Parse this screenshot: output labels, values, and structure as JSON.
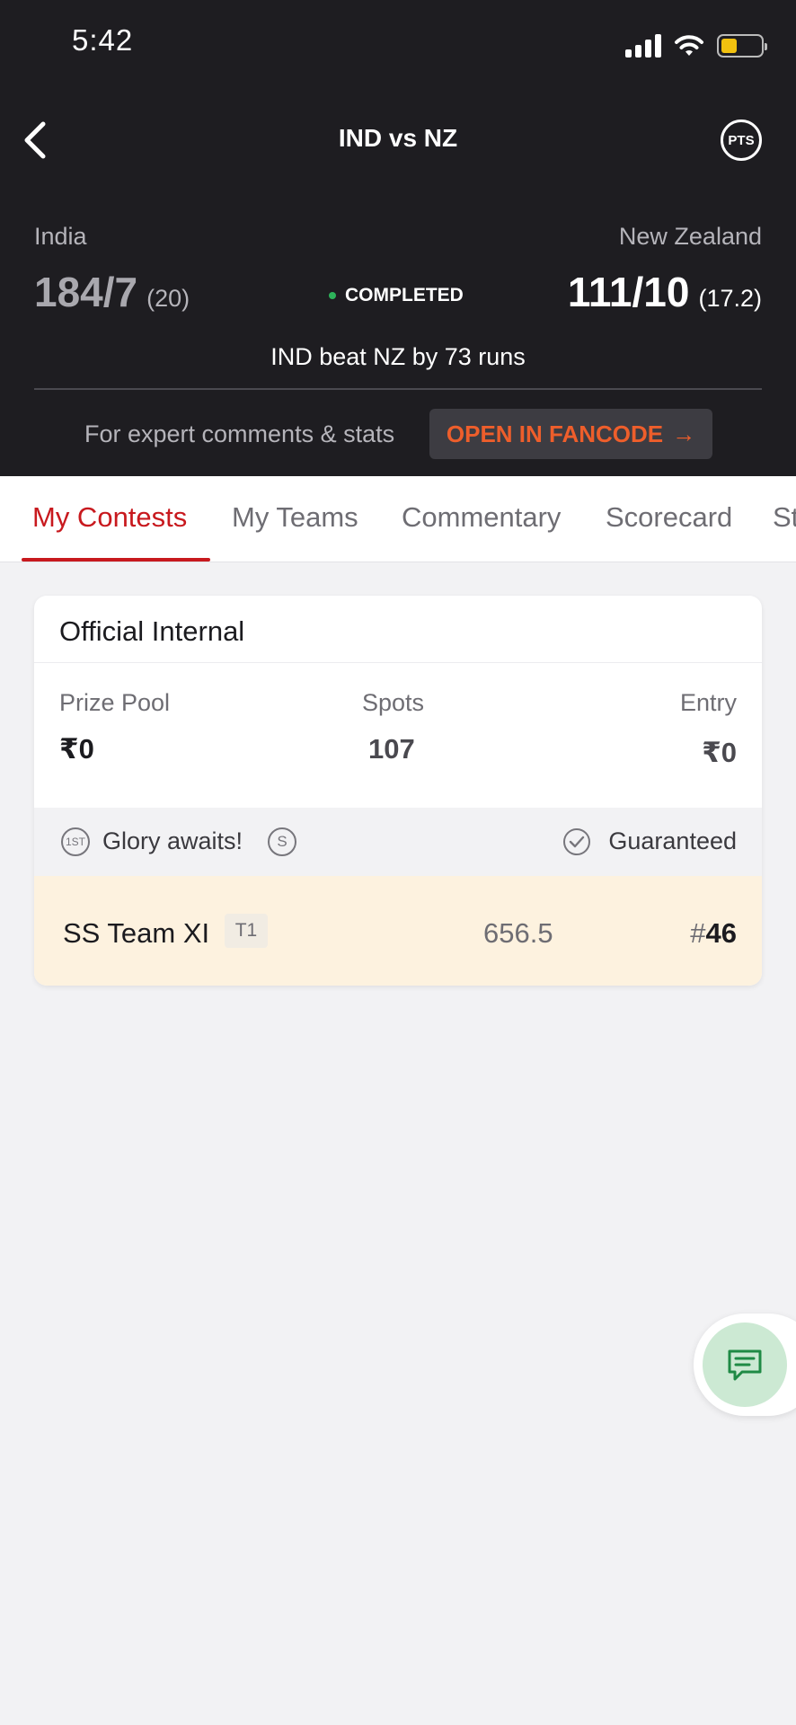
{
  "status_bar": {
    "time": "5:42"
  },
  "header": {
    "title": "IND vs NZ",
    "pts_label": "PTS",
    "team_left": {
      "name": "India",
      "score": "184/7",
      "overs": "(20)"
    },
    "team_right": {
      "name": "New Zealand",
      "score": "111/10",
      "overs": "(17.2)"
    },
    "status": "COMPLETED",
    "result": "IND beat NZ by 73 runs",
    "expert_text": "For expert comments & stats",
    "fancode_label": "OPEN IN FANCODE",
    "fancode_arrow": "→"
  },
  "tabs": [
    {
      "label": "My Contests",
      "active": true
    },
    {
      "label": "My Teams"
    },
    {
      "label": "Commentary"
    },
    {
      "label": "Scorecard"
    },
    {
      "label": "St"
    }
  ],
  "contest": {
    "title": "Official Internal",
    "prize_pool_label": "Prize Pool",
    "prize_pool_value": "₹0",
    "spots_label": "Spots",
    "spots_value": "107",
    "entry_label": "Entry",
    "entry_value": "₹0",
    "first_badge": "1ST",
    "glory_text": "Glory awaits!",
    "s_badge": "S",
    "guaranteed_text": "Guaranteed",
    "team": {
      "name": "SS Team XI",
      "tag": "T1",
      "points": "656.5",
      "rank_hash": "#",
      "rank": "46"
    }
  },
  "colors": {
    "accent": "#c8191e",
    "fancode": "#ee5e2b",
    "header_bg": "#1e1d21",
    "chat_fab": "#cce9d3"
  },
  "icons": {
    "back": "chevron-left-icon",
    "chat": "chat-icon",
    "check": "check-circle-icon"
  }
}
